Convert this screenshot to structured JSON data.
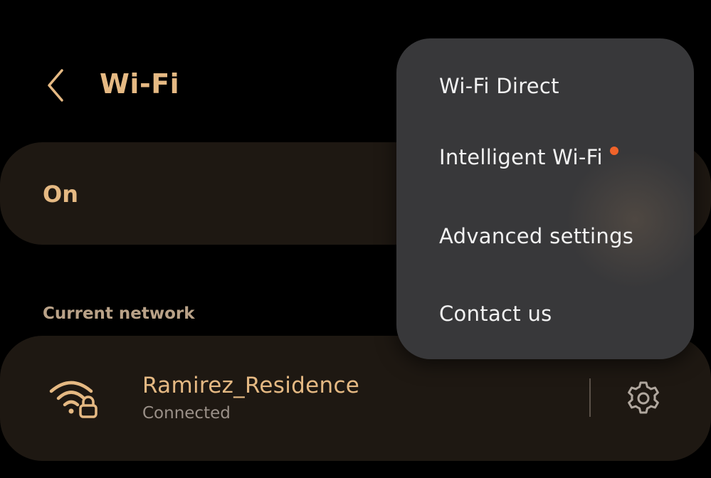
{
  "header": {
    "title": "Wi-Fi",
    "back_icon": "chevron-left-icon"
  },
  "wifi_toggle": {
    "label": "On",
    "state": "on"
  },
  "current_network": {
    "section_label": "Current network",
    "name": "Ramirez_Residence",
    "status": "Connected",
    "icon": "wifi-lock-icon",
    "settings_icon": "gear-icon"
  },
  "overflow_menu": {
    "items": [
      {
        "label": "Wi-Fi Direct",
        "badge": false
      },
      {
        "label": "Intelligent Wi-Fi",
        "badge": true
      },
      {
        "label": "Advanced settings",
        "badge": false
      },
      {
        "label": "Contact us",
        "badge": false
      }
    ]
  },
  "colors": {
    "accent": "#e5b983",
    "background": "#000000",
    "card": "#1e1812",
    "menu": "#38383a",
    "badge": "#f0632a"
  }
}
